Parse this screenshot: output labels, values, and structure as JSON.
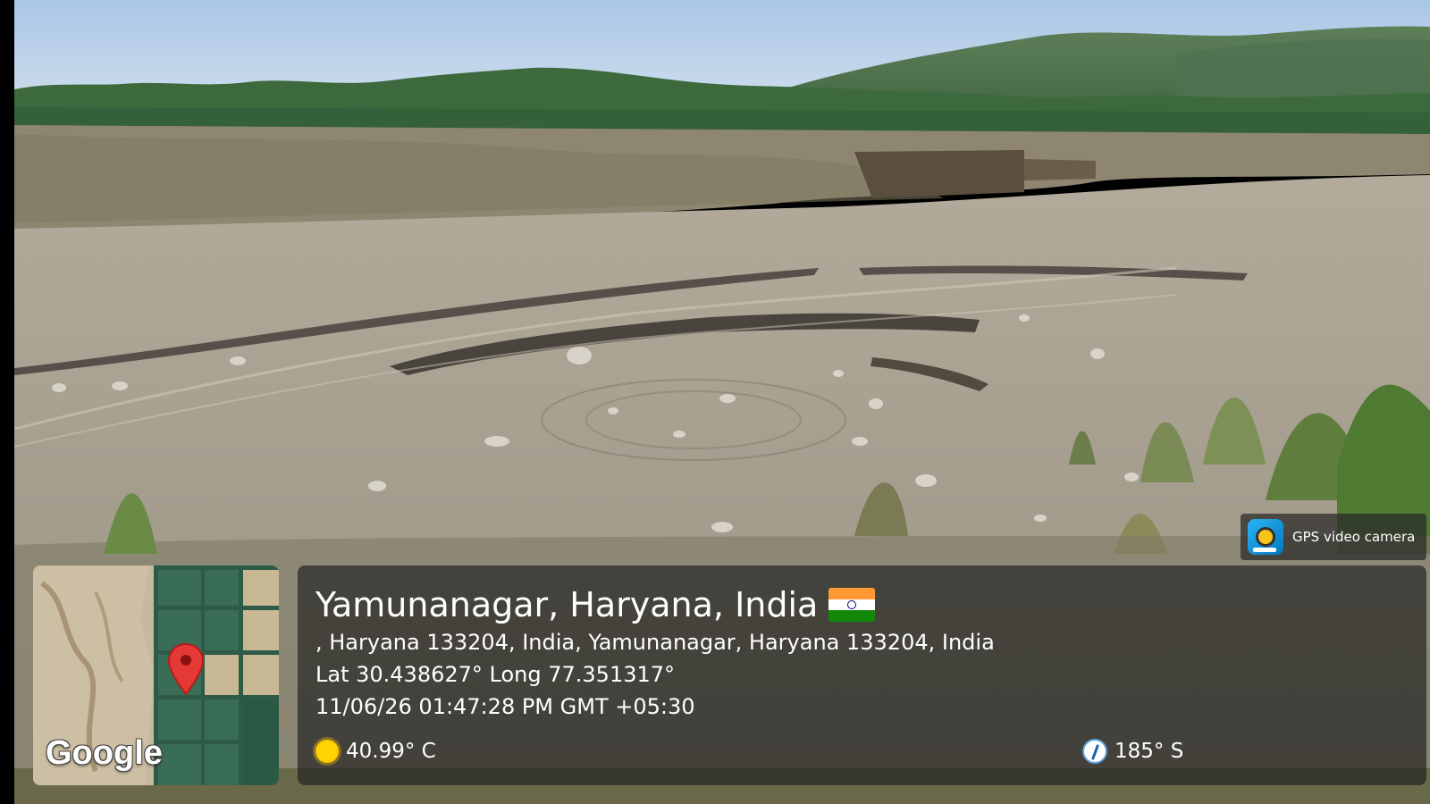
{
  "overlay": {
    "app_badge": {
      "label": "GPS video camera",
      "icon": "camera-app-icon"
    },
    "map": {
      "logo_text": "Google",
      "pin_icon": "map-pin-icon"
    },
    "location": {
      "title": "Yamunanagar, Haryana, India",
      "flag_icon": "india-flag-icon",
      "address": ", Haryana 133204, India, Yamunanagar, Haryana 133204, India",
      "coordinates": "Lat 30.438627° Long 77.351317°",
      "datetime": "11/06/26 01:47:28 PM GMT +05:30"
    },
    "weather": {
      "icon": "sun-icon",
      "temperature": "40.99° C"
    },
    "compass": {
      "icon": "compass-icon",
      "heading": "185° S"
    }
  }
}
